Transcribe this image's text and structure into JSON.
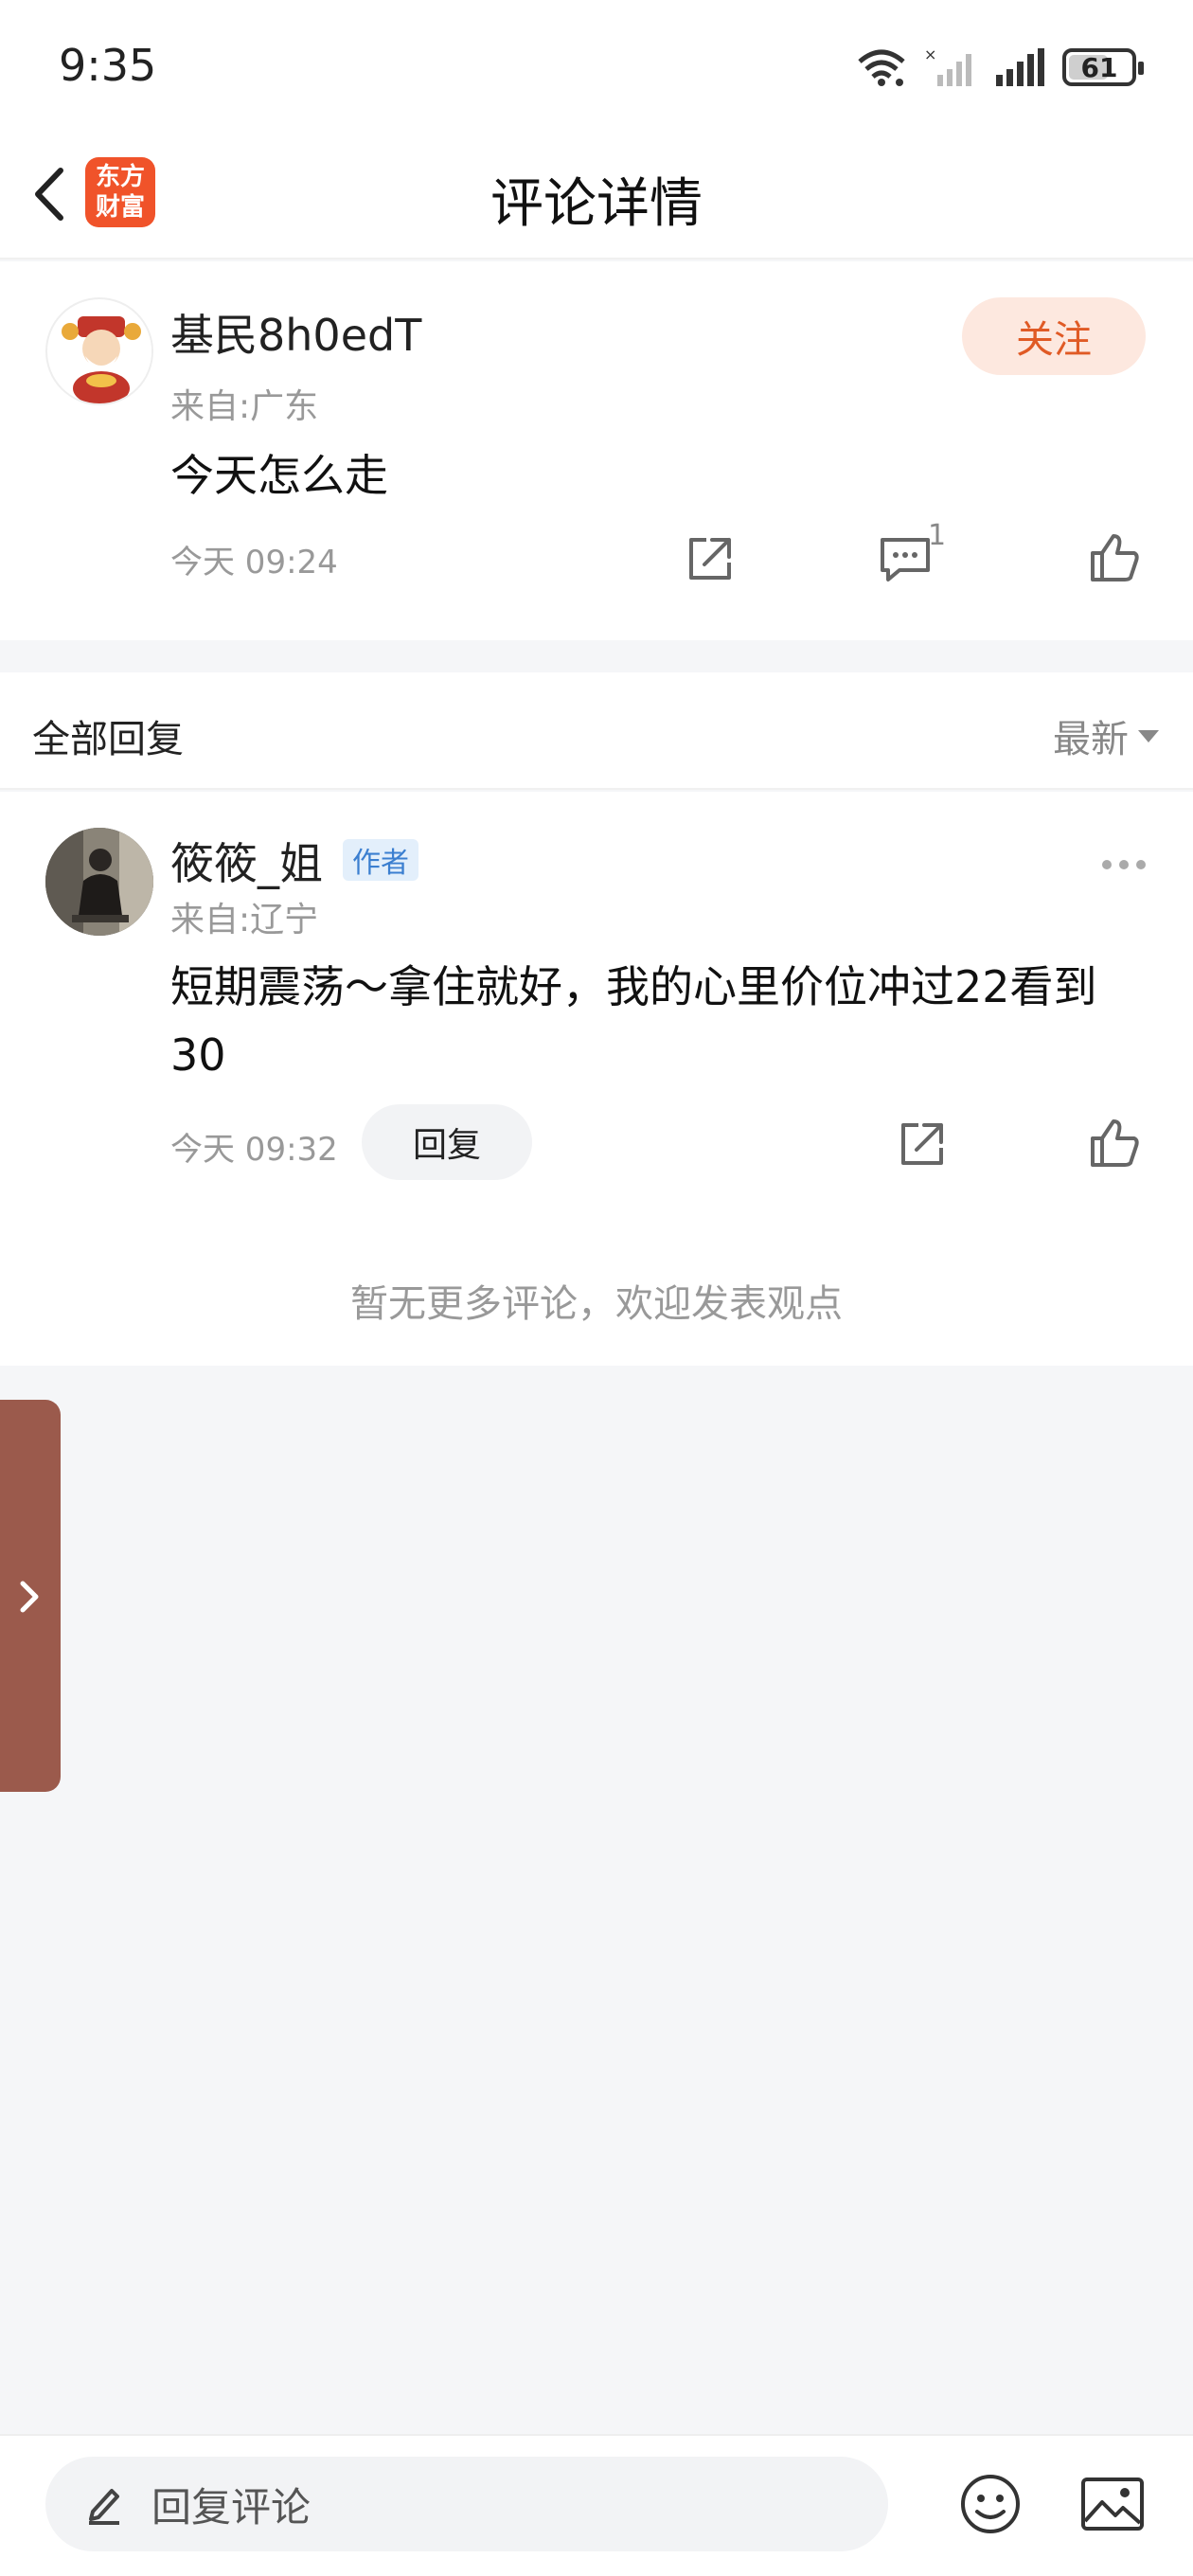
{
  "status_bar": {
    "time": "9:35",
    "battery": "61"
  },
  "nav": {
    "title": "评论详情",
    "logo_text": "东方财富"
  },
  "main_comment": {
    "author": "基民8h0edT",
    "location": "来自:广东",
    "content": "今天怎么走",
    "time": "今天 09:24",
    "follow_label": "关注",
    "comment_count": "1"
  },
  "replies": {
    "title": "全部回复",
    "sort_label": "最新",
    "items": [
      {
        "author": "筱筱_姐",
        "badge": "作者",
        "location": "来自:辽宁",
        "content": "短期震荡～拿住就好，我的心里价位冲过22看到30",
        "time": "今天 09:32",
        "reply_label": "回复"
      }
    ],
    "empty_hint": "暂无更多评论，欢迎发表观点"
  },
  "bottom_bar": {
    "input_placeholder": "回复评论"
  },
  "colors": {
    "accent": "#e05a25",
    "logo_bg": "#f0532a",
    "badge_blue": "#3b7fd0",
    "side_tab": "#9b5a4c"
  }
}
